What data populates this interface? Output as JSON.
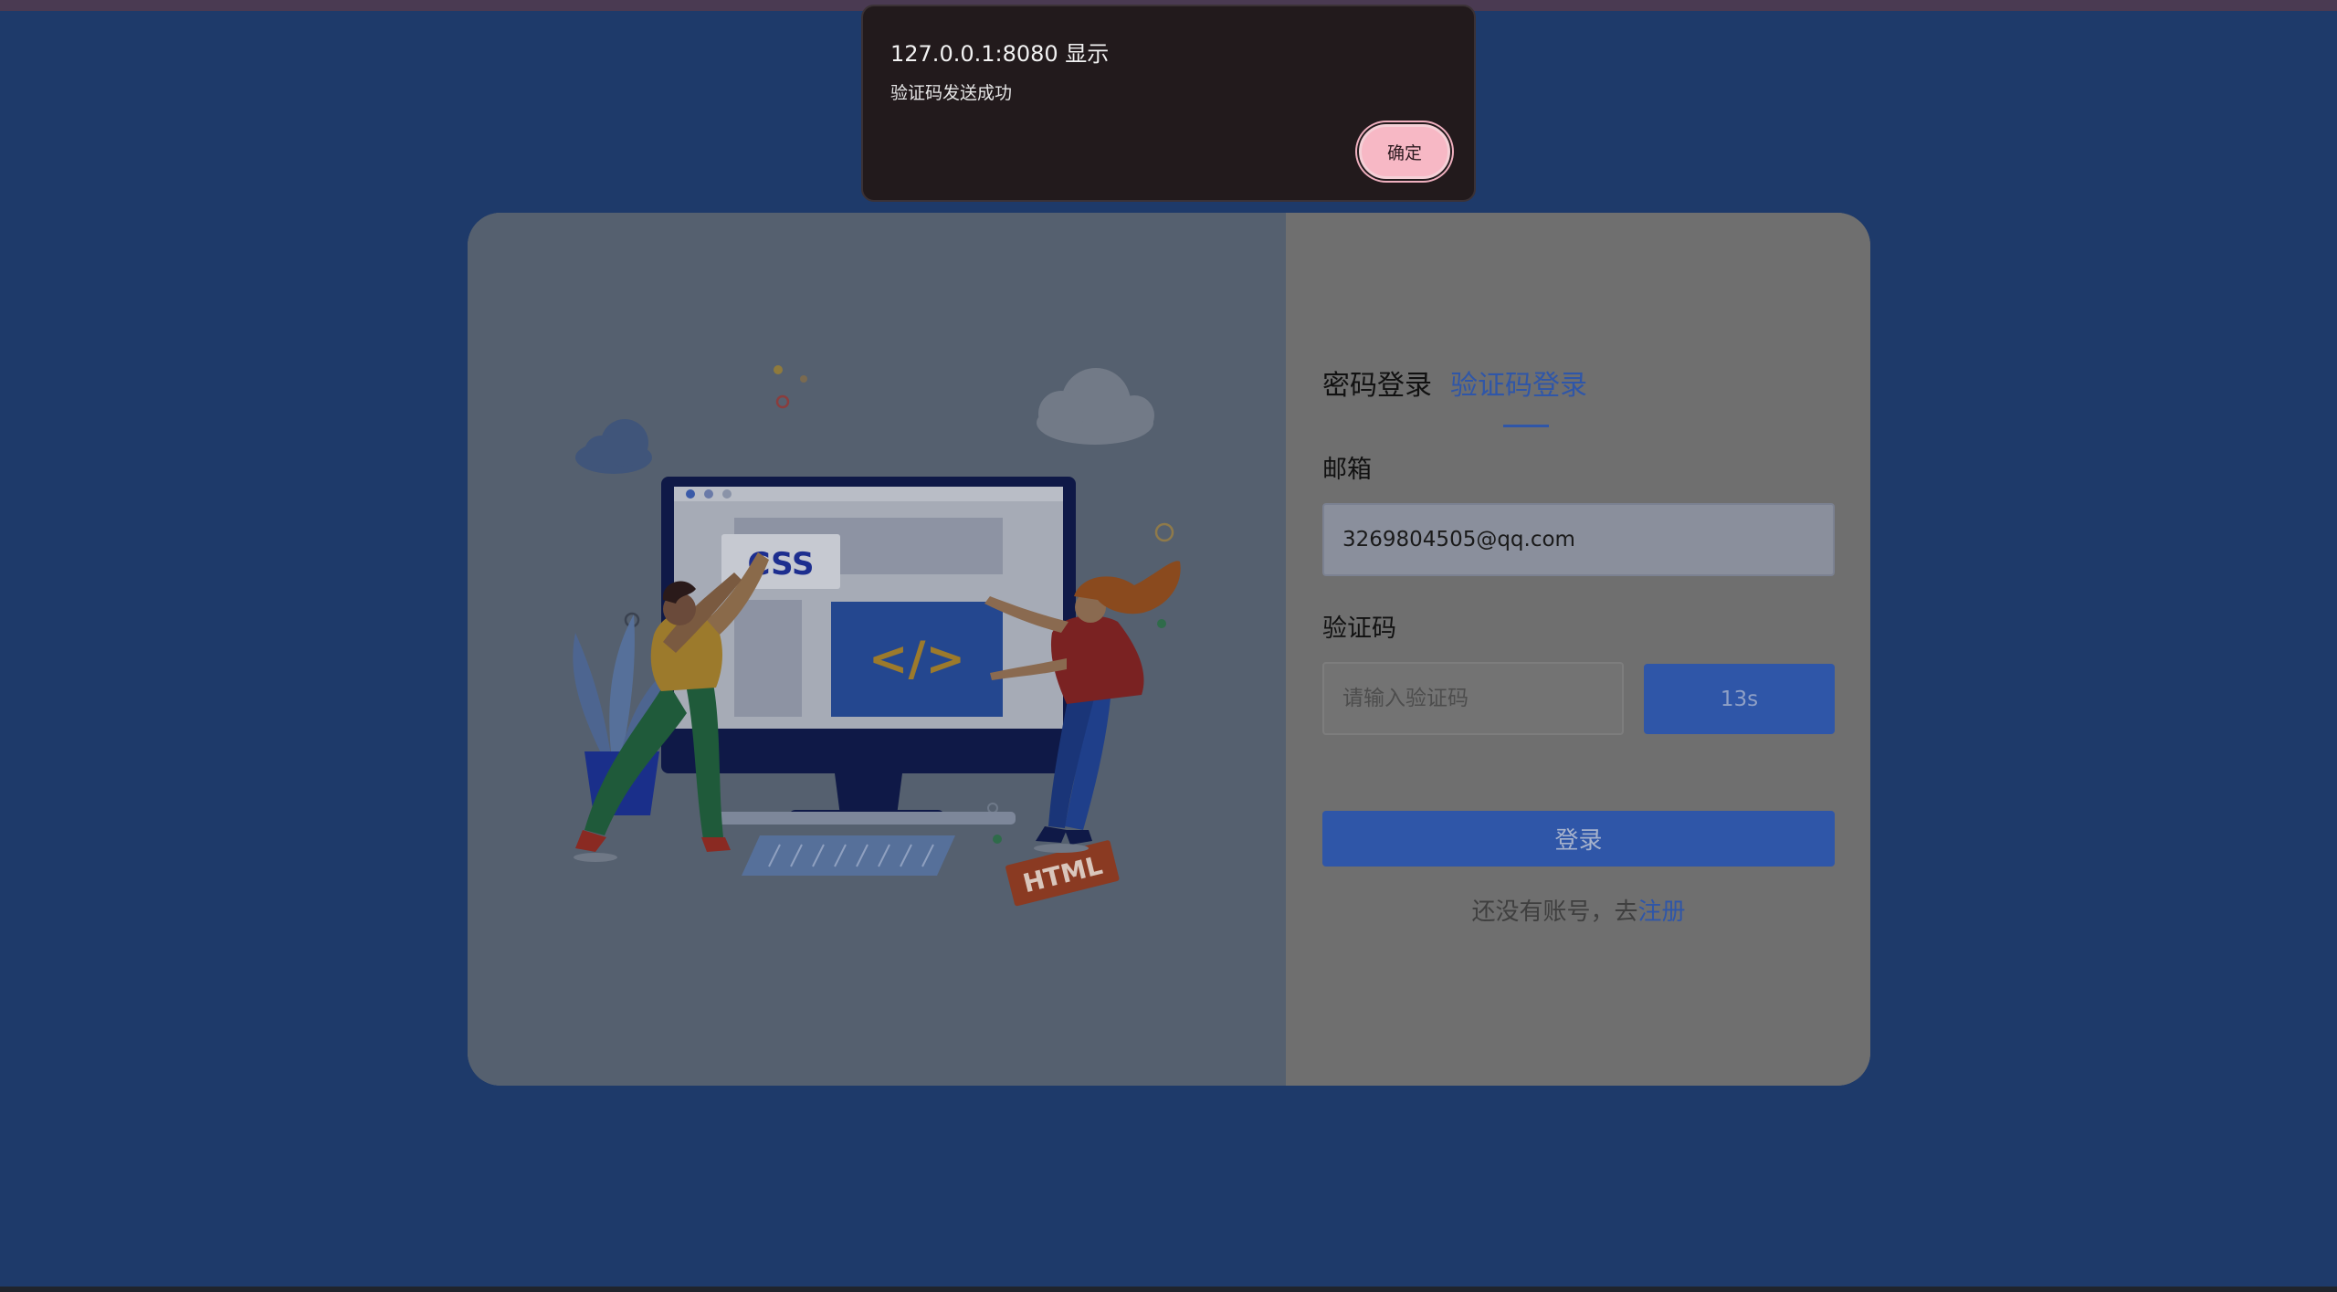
{
  "dialog": {
    "title": "127.0.0.1:8080 显示",
    "message": "验证码发送成功",
    "ok_label": "确定"
  },
  "login": {
    "tabs": [
      {
        "label": "密码登录",
        "active": false
      },
      {
        "label": "验证码登录",
        "active": true
      }
    ],
    "email_label": "邮箱",
    "email_value": "3269804505@qq.com",
    "code_label": "验证码",
    "code_placeholder": "请输入验证码",
    "send_code_label": "13s",
    "submit_label": "登录",
    "register_prompt": "还没有账号，去",
    "register_link": "注册"
  },
  "illustration": {
    "badge_css": "CSS",
    "badge_code": "</>",
    "badge_html": "HTML"
  },
  "colors": {
    "page_background": "#1e3a6a",
    "accent": "#2f56a8",
    "dialog_background": "#221a1c",
    "dialog_button": "#f7b8c5"
  }
}
